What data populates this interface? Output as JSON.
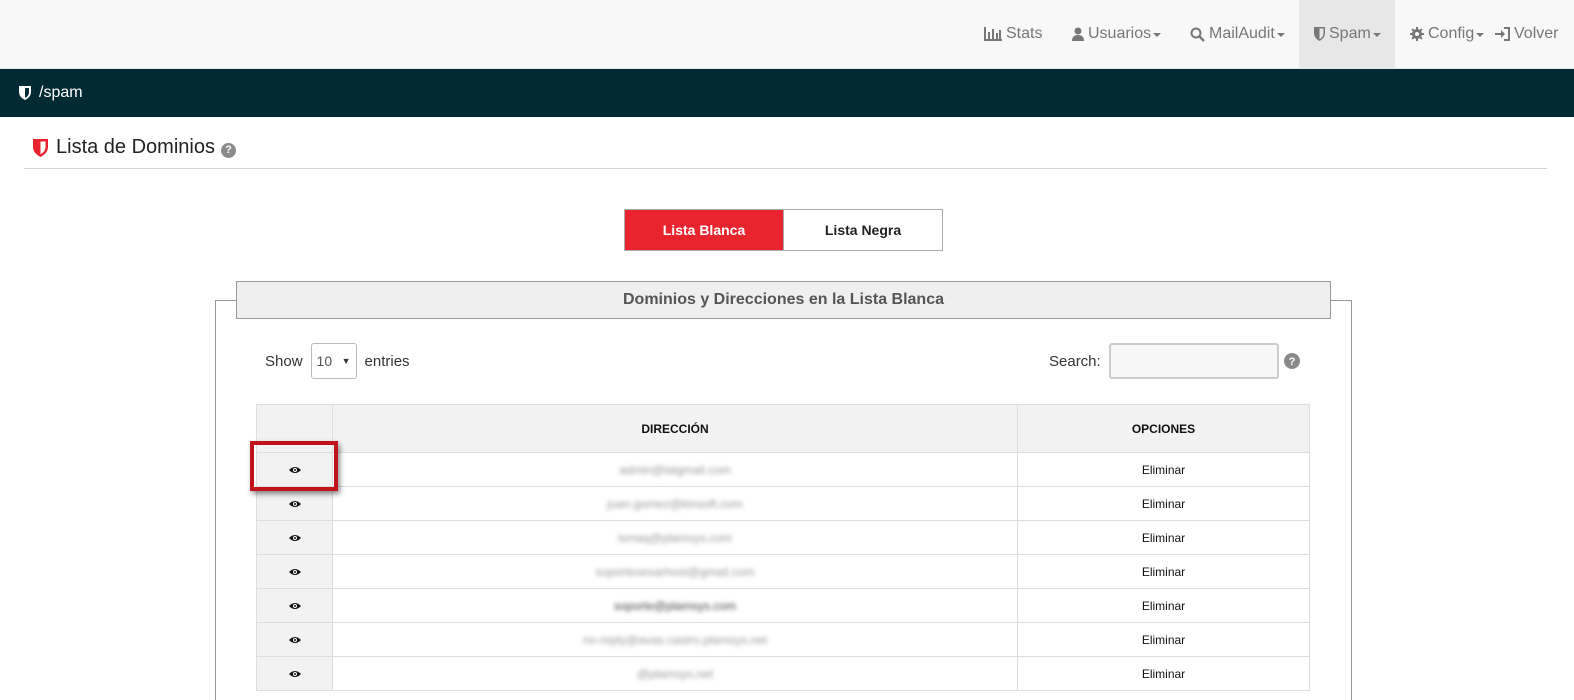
{
  "nav": {
    "items": [
      {
        "label": "Stats",
        "icon": "bar-chart-icon"
      },
      {
        "label": "Usuarios",
        "icon": "user-icon",
        "dropdown": true
      },
      {
        "label": "MailAudit",
        "icon": "search-icon",
        "dropdown": true
      },
      {
        "label": "Spam",
        "icon": "shield-icon",
        "dropdown": true,
        "active": true
      },
      {
        "label": "Config",
        "icon": "gear-icon",
        "dropdown": true
      },
      {
        "label": "Volver",
        "icon": "sign-in-icon"
      }
    ]
  },
  "breadcrumb": {
    "path": "/spam"
  },
  "page": {
    "title": "Lista de Dominios",
    "help": "?"
  },
  "tabs": [
    {
      "label": "Lista Blanca",
      "active": true
    },
    {
      "label": "Lista Negra",
      "active": false
    }
  ],
  "panel": {
    "title": "Dominios y Direcciones en la Lista Blanca",
    "show_label": "Show",
    "entries_value": "10",
    "entries_label": "entries",
    "search_label": "Search:",
    "search_value": ""
  },
  "table": {
    "headers": [
      "",
      "DIRECCIÓN",
      "OPCIONES"
    ],
    "rows": [
      {
        "address": "admin@lalgmail.com",
        "option": "Eliminar"
      },
      {
        "address": "juan.gomez@kinsoft.com",
        "option": "Eliminar"
      },
      {
        "address": "ismaq@plamsys.com",
        "option": "Eliminar"
      },
      {
        "address": "soportesesarhost@gmail.com",
        "option": "Eliminar"
      },
      {
        "address": "soporte@plamsys.com",
        "option": "Eliminar"
      },
      {
        "address": "no-reply@avas.castro.plamsys.net",
        "option": "Eliminar"
      },
      {
        "address": "@plamsys.net",
        "option": "Eliminar"
      }
    ]
  },
  "colors": {
    "accent": "#e8242f",
    "header_bar": "#012a32",
    "highlight": "#c0141c"
  }
}
